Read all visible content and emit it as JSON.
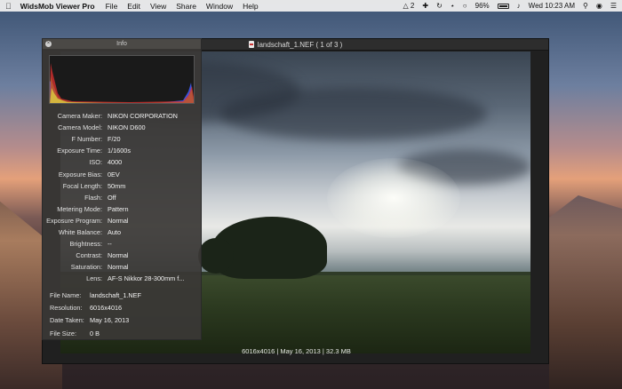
{
  "menubar": {
    "app_name": "WidsMob Viewer Pro",
    "menus": [
      "File",
      "Edit",
      "View",
      "Share",
      "Window",
      "Help"
    ],
    "status": {
      "adobe_badge": "2",
      "battery": "96%",
      "clock": "Wed 10:23 AM"
    }
  },
  "viewer": {
    "title": "landschaft_1.NEF ( 1 of 3 )",
    "caption": "6016x4016 | May 16, 2013 | 32.3 MB"
  },
  "info": {
    "title": "Info",
    "exif": [
      {
        "label": "Camera Maker:",
        "value": "NIKON CORPORATION"
      },
      {
        "label": "Camera Model:",
        "value": "NIKON D600"
      },
      {
        "label": "F Number:",
        "value": "F/20"
      },
      {
        "label": "Exposure Time:",
        "value": "1/1600s"
      },
      {
        "label": "ISO:",
        "value": "4000"
      },
      {
        "label": "Exposure Bias:",
        "value": "0EV"
      },
      {
        "label": "Focal Length:",
        "value": "50mm"
      },
      {
        "label": "Flash:",
        "value": "Off"
      },
      {
        "label": "Metering Mode:",
        "value": "Pattern"
      },
      {
        "label": "Exposure Program:",
        "value": "Normal"
      },
      {
        "label": "White Balance:",
        "value": "Auto"
      },
      {
        "label": "Brightness:",
        "value": "--"
      },
      {
        "label": "Contrast:",
        "value": "Normal"
      },
      {
        "label": "Saturation:",
        "value": "Normal"
      },
      {
        "label": "Lens:",
        "value": "AF-S Nikkor 28-300mm f..."
      }
    ],
    "file": [
      {
        "label": "File Name:",
        "value": "landschaft_1.NEF"
      },
      {
        "label": "Resolution:",
        "value": "6016x4016"
      },
      {
        "label": "Date Taken:",
        "value": "May 16, 2013"
      },
      {
        "label": "File Size:",
        "value": "0 B"
      }
    ]
  },
  "colors": {
    "histogram_red": "#e03030",
    "histogram_green": "#40d040",
    "histogram_blue": "#4060ff"
  }
}
